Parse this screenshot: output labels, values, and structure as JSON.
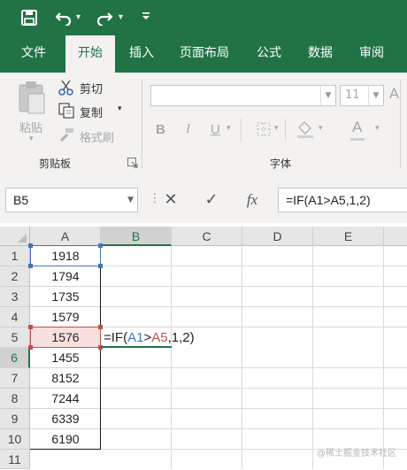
{
  "quick_access": {
    "save_icon": "save-icon",
    "undo_icon": "undo-icon",
    "redo_icon": "redo-icon",
    "customize_icon": "customize-quick-access-icon"
  },
  "tabs": [
    {
      "label": "文件",
      "active": false
    },
    {
      "label": "开始",
      "active": true
    },
    {
      "label": "插入",
      "active": false
    },
    {
      "label": "页面布局",
      "active": false
    },
    {
      "label": "公式",
      "active": false
    },
    {
      "label": "数据",
      "active": false
    },
    {
      "label": "审阅",
      "active": false
    }
  ],
  "ribbon": {
    "clipboard": {
      "paste_label": "粘贴",
      "cut_label": "剪切",
      "copy_label": "复制",
      "format_painter_label": "格式刷",
      "group_label": "剪贴板"
    },
    "font": {
      "font_size_value": "11",
      "bold_label": "B",
      "italic_label": "I",
      "underline_label": "U",
      "group_label": "字体"
    }
  },
  "formula_bar": {
    "name_box": "B5",
    "cancel_symbol": "✕",
    "enter_symbol": "✓",
    "fx_label": "fx",
    "formula": "=IF(A1>A5,1,2)"
  },
  "sheet": {
    "columns": [
      "A",
      "B",
      "C",
      "D",
      "E"
    ],
    "selected_column": "B",
    "rows": [
      "1",
      "2",
      "3",
      "4",
      "5",
      "6",
      "7",
      "8",
      "9",
      "10",
      "11"
    ],
    "selected_row": "6",
    "column_a_values": [
      "1918",
      "1794",
      "1735",
      "1579",
      "1576",
      "1455",
      "8152",
      "7244",
      "6339",
      "6190"
    ],
    "editing_cell": {
      "address": "B5",
      "parts": [
        "=IF(",
        "A1",
        ">",
        "A5",
        ",1,2)"
      ]
    }
  },
  "colors": {
    "accent_green": "#217346",
    "ref_a1_blue": "#4472c4",
    "ref_a5_red": "#c0504d"
  },
  "watermark": "@稀土掘金技术社区"
}
